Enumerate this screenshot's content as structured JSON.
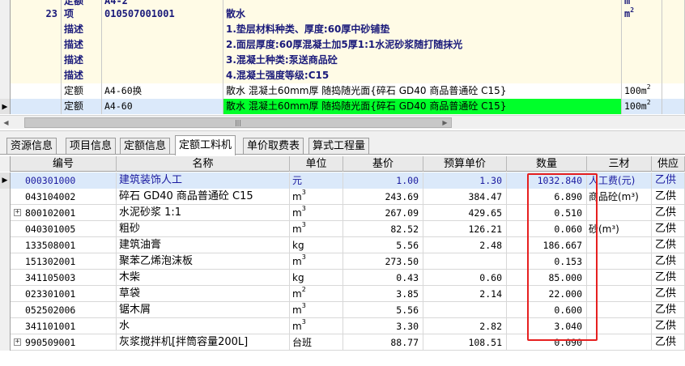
{
  "top_grid": {
    "rows": [
      {
        "type": "partial",
        "no": "",
        "kind": "定额",
        "code": "A4-2",
        "name": "",
        "unit": "m²"
      },
      {
        "type": "item",
        "no": "23",
        "kind": "项",
        "code": "010507001001",
        "name": "散水",
        "unit": "m²"
      },
      {
        "type": "desc",
        "no": "",
        "kind": "描述",
        "code": "",
        "name": "1.垫层材料种类、厚度:60厚中砂铺垫",
        "unit": ""
      },
      {
        "type": "desc",
        "no": "",
        "kind": "描述",
        "code": "",
        "name": "2.面层厚度:60厚混凝土加5厚1:1水泥砂浆随打随抹光",
        "unit": ""
      },
      {
        "type": "desc",
        "no": "",
        "kind": "描述",
        "code": "",
        "name": "3.混凝土种类:泵送商品砼",
        "unit": ""
      },
      {
        "type": "desc",
        "no": "",
        "kind": "描述",
        "code": "",
        "name": "4.混凝土强度等级:C15",
        "unit": ""
      },
      {
        "type": "quota",
        "no": "",
        "kind": "定额",
        "code": "A4-60换",
        "name": "散水 混凝土60mm厚 随捣随光面{碎石 GD40  商品普通砼  C15}",
        "unit": "100m²"
      },
      {
        "type": "quota-sel",
        "no": "",
        "kind": "定额",
        "code": "A4-60",
        "name": "散水 混凝土60mm厚 随捣随光面{碎石 GD40  商品普通砼  C15}",
        "unit": "100m²"
      }
    ]
  },
  "scrollbar": {
    "thumb_grip": "|||"
  },
  "tabs": [
    {
      "label": "资源信息",
      "active": false
    },
    {
      "label": "项目信息",
      "active": false
    },
    {
      "label": "定额信息",
      "active": false
    },
    {
      "label": "定额工料机",
      "active": true
    },
    {
      "label": "单价取费表",
      "active": false
    },
    {
      "label": "算式工程量",
      "active": false
    }
  ],
  "bottom_grid": {
    "headers": [
      "编号",
      "名称",
      "单位",
      "基价",
      "预算单价",
      "数量",
      "三材",
      "供应"
    ],
    "rows": [
      {
        "code": "000301000",
        "name": "建筑装饰人工",
        "unit": "元",
        "base": "1.00",
        "budget": "1.30",
        "qty": "1032.840",
        "mat": "人工费(元)",
        "supply": "乙供",
        "expand": false,
        "selected": true
      },
      {
        "code": "043104002",
        "name": "碎石 GD40  商品普通砼  C15",
        "unit": "m³",
        "base": "243.69",
        "budget": "384.47",
        "qty": "6.890",
        "mat": "商品砼(m³)",
        "supply": "乙供",
        "expand": false,
        "selected": false
      },
      {
        "code": "800102001",
        "name": "水泥砂浆 1:1",
        "unit": "m³",
        "base": "267.09",
        "budget": "429.65",
        "qty": "0.510",
        "mat": "",
        "supply": "乙供",
        "expand": true,
        "selected": false
      },
      {
        "code": "040301005",
        "name": "粗砂",
        "unit": "m³",
        "base": "82.52",
        "budget": "126.21",
        "qty": "0.060",
        "mat": "砂(m³)",
        "supply": "乙供",
        "expand": false,
        "selected": false
      },
      {
        "code": "133508001",
        "name": "建筑油膏",
        "unit": "kg",
        "base": "5.56",
        "budget": "2.48",
        "qty": "186.667",
        "mat": "",
        "supply": "乙供",
        "expand": false,
        "selected": false
      },
      {
        "code": "151302001",
        "name": "聚苯乙烯泡沫板",
        "unit": "m³",
        "base": "273.50",
        "budget": "",
        "qty": "0.153",
        "mat": "",
        "supply": "乙供",
        "expand": false,
        "selected": false
      },
      {
        "code": "341105003",
        "name": "木柴",
        "unit": "kg",
        "base": "0.43",
        "budget": "0.60",
        "qty": "85.000",
        "mat": "",
        "supply": "乙供",
        "expand": false,
        "selected": false
      },
      {
        "code": "023301001",
        "name": "草袋",
        "unit": "m²",
        "base": "3.85",
        "budget": "2.14",
        "qty": "22.000",
        "mat": "",
        "supply": "乙供",
        "expand": false,
        "selected": false
      },
      {
        "code": "052502006",
        "name": "锯木屑",
        "unit": "m³",
        "base": "5.56",
        "budget": "",
        "qty": "0.600",
        "mat": "",
        "supply": "乙供",
        "expand": false,
        "selected": false
      },
      {
        "code": "341101001",
        "name": "水",
        "unit": "m³",
        "base": "3.30",
        "budget": "2.82",
        "qty": "3.040",
        "mat": "",
        "supply": "乙供",
        "expand": false,
        "selected": false
      },
      {
        "code": "990509001",
        "name": "灰浆搅拌机[拌筒容量200L]",
        "unit": "台班",
        "base": "88.77",
        "budget": "108.51",
        "qty": "0.090",
        "mat": "",
        "supply": "乙供",
        "expand": true,
        "selected": false
      }
    ]
  },
  "colors": {
    "highlight_green": "#00ff2a",
    "selection_blue": "#dbe9fa",
    "annotation_red": "#e62020",
    "row_yellow": "#fffbe6"
  }
}
